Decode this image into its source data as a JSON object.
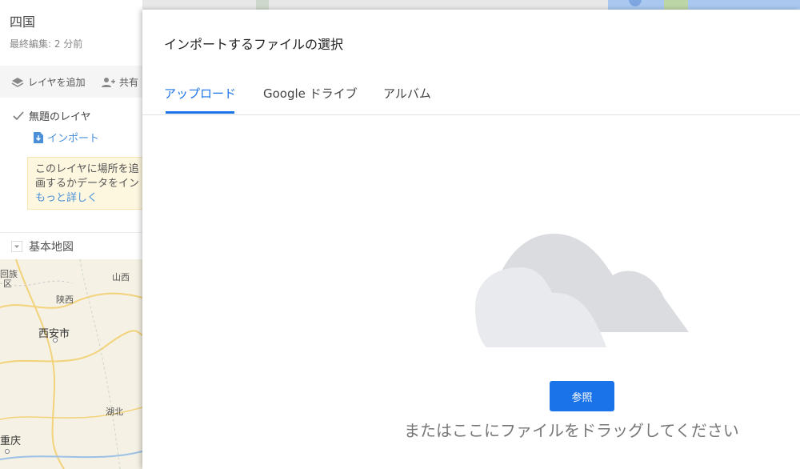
{
  "sidebar": {
    "title": "四国",
    "last_edit": "最終編集: 2 分前",
    "add_layer": "レイヤを追加",
    "share": "共有",
    "layer_name": "無題のレイヤ",
    "import": "インポート",
    "hint_line1": "このレイヤに場所を追",
    "hint_line2": "画するかデータをイン",
    "hint_more": "もっと詳しく",
    "base_map": "基本地図"
  },
  "mini_map": {
    "labels": [
      "回族",
      "区",
      "山西",
      "陕西",
      "西安市",
      "湖北",
      "重庆"
    ]
  },
  "dialog": {
    "title": "インポートするファイルの選択",
    "tabs": [
      "アップロード",
      "Google ドライブ",
      "アルバム"
    ],
    "active_tab": "アップロード",
    "browse_label": "参照",
    "drag_hint": "またはここにファイルをドラッグしてください"
  },
  "colors": {
    "accent": "#1a73e8",
    "link": "#4a90d9",
    "hint_bg": "#fef7e0",
    "cloud_back": "#dadce0",
    "cloud_front": "#e8eaed"
  }
}
